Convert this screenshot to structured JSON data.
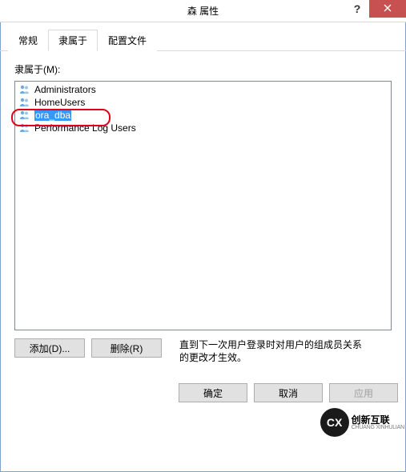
{
  "window": {
    "title": "森 属性",
    "help_symbol": "?"
  },
  "tabs": {
    "t0": "常规",
    "t1": "隶属于",
    "t2": "配置文件"
  },
  "member_of": {
    "label": "隶属于(M):",
    "items": {
      "i0": "Administrators",
      "i1": "HomeUsers",
      "i2": "ora_dba",
      "i3": "Performance Log Users"
    }
  },
  "buttons": {
    "add": "添加(D)...",
    "remove": "删除(R)",
    "ok": "确定",
    "cancel": "取消",
    "apply": "应用"
  },
  "hint": "直到下一次用户登录时对用户的组成员关系的更改才生效。",
  "watermark": {
    "logo": "CX",
    "cn": "创新互联",
    "en": "CHUANG XINHULIAN"
  }
}
